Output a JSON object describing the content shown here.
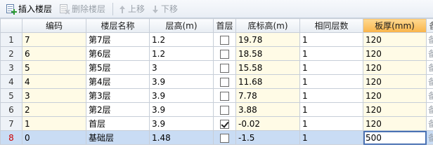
{
  "toolbar": {
    "insert_label": "插入楼层",
    "delete_label": "删除楼层",
    "move_up_label": "上移",
    "move_down_label": "下移"
  },
  "table": {
    "headers": [
      "编码",
      "楼层名称",
      "层高(m)",
      "首层",
      "底标高(m)",
      "相同层数",
      "板厚(mm)",
      "备"
    ],
    "rows": [
      {
        "num": "1",
        "code": "7",
        "name": "第7层",
        "height": "1.2",
        "first": false,
        "base": "19.78",
        "same": "1",
        "slab": "120",
        "extra": "备"
      },
      {
        "num": "2",
        "code": "6",
        "name": "第6层",
        "height": "1.2",
        "first": false,
        "base": "18.58",
        "same": "1",
        "slab": "120",
        "extra": "备"
      },
      {
        "num": "3",
        "code": "5",
        "name": "第5层",
        "height": "3",
        "first": false,
        "base": "15.58",
        "same": "1",
        "slab": "120",
        "extra": "备"
      },
      {
        "num": "4",
        "code": "4",
        "name": "第4层",
        "height": "3.9",
        "first": false,
        "base": "11.68",
        "same": "1",
        "slab": "120",
        "extra": "备"
      },
      {
        "num": "5",
        "code": "3",
        "name": "第3层",
        "height": "3.9",
        "first": false,
        "base": "7.78",
        "same": "1",
        "slab": "120",
        "extra": "备"
      },
      {
        "num": "6",
        "code": "2",
        "name": "第2层",
        "height": "3.9",
        "first": false,
        "base": "3.88",
        "same": "1",
        "slab": "120",
        "extra": "备"
      },
      {
        "num": "7",
        "code": "1",
        "name": "首层",
        "height": "3.9",
        "first": true,
        "base": "-0.02",
        "same": "1",
        "slab": "120",
        "extra": "备"
      },
      {
        "num": "8",
        "code": "0",
        "name": "基础层",
        "height": "1.48",
        "first": false,
        "base": "-1.5",
        "same": "1",
        "slab": "500",
        "extra": "备"
      }
    ]
  },
  "colors": {
    "selected_row": "#c9dcf4",
    "highlight_header": "#f9b44a",
    "editable_cell": "#fffbe6"
  }
}
